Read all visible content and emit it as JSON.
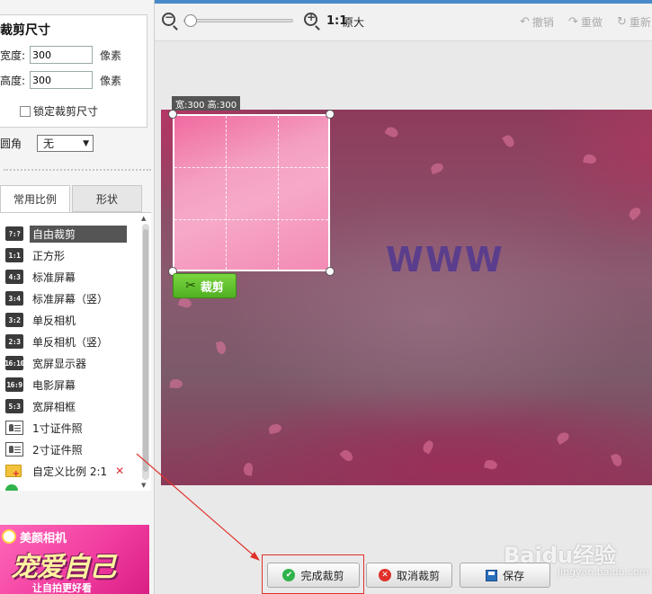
{
  "crop_size": {
    "title": "裁剪尺寸",
    "width_label": "宽度:",
    "width_value": "300",
    "height_label": "高度:",
    "height_value": "300",
    "unit": "像素",
    "lock_label": "锁定裁剪尺寸",
    "corner_label": "圆角",
    "corner_value": "无"
  },
  "tabs": {
    "common": "常用比例",
    "shape": "形状"
  },
  "ratios": [
    {
      "icon": "?:?",
      "label": "自由裁剪"
    },
    {
      "icon": "1:1",
      "label": "正方形"
    },
    {
      "icon": "4:3",
      "label": "标准屏幕"
    },
    {
      "icon": "3:4",
      "label": "标准屏幕（竖）"
    },
    {
      "icon": "3:2",
      "label": "单反相机"
    },
    {
      "icon": "2:3",
      "label": "单反相机（竖）"
    },
    {
      "icon": "16:10",
      "label": "宽屏显示器"
    },
    {
      "icon": "16:9",
      "label": "电影屏幕"
    },
    {
      "icon": "5:3",
      "label": "宽屏相框"
    },
    {
      "label": "1寸证件照"
    },
    {
      "label": "2寸证件照"
    },
    {
      "label": "自定义比例 2:1"
    }
  ],
  "ad": {
    "title": "美颜相机",
    "slogan": "宠爱自己",
    "sub": "让自拍更好看"
  },
  "toolbar": {
    "ratio": "1:1",
    "original": "原大",
    "undo": "撤销",
    "redo": "重做",
    "reset": "重新"
  },
  "canvas": {
    "crop_label": "宽:300 高:300",
    "photo_text": "WWW",
    "crop_button": "裁剪"
  },
  "buttons": {
    "finish": "完成裁剪",
    "cancel": "取消裁剪",
    "save": "保存"
  },
  "watermark": {
    "main": "Baidu经验",
    "sub": "jingyan.baidu.com"
  },
  "colors": {
    "accent_green": "#4fb021",
    "highlight_red": "#e0302a",
    "selected_bg": "#555555"
  }
}
